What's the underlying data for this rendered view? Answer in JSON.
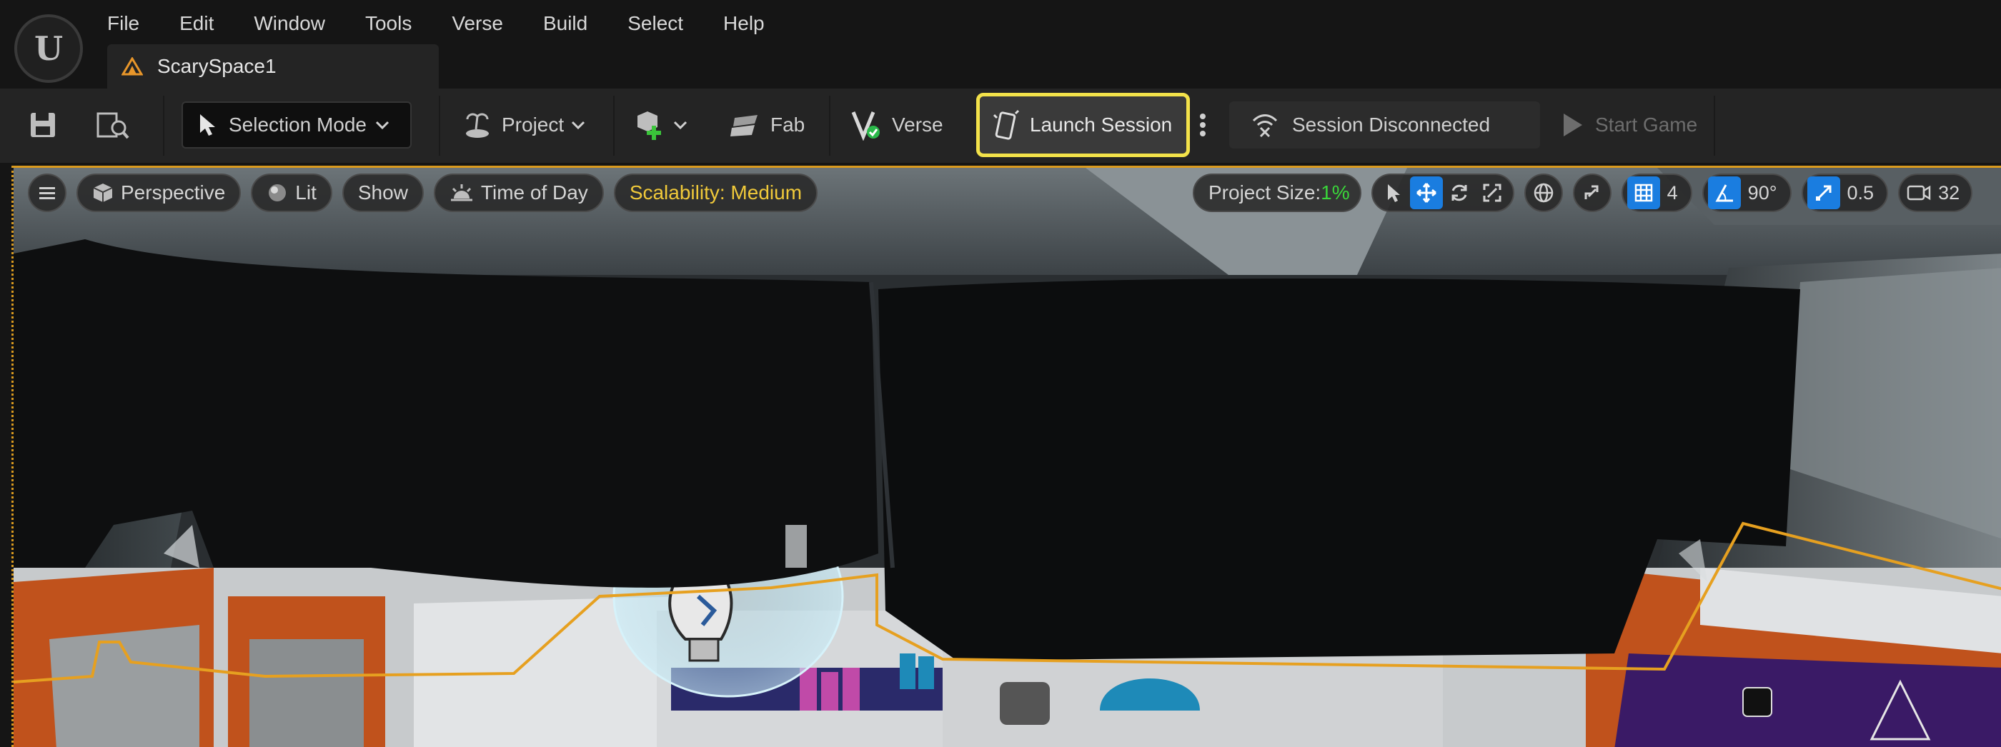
{
  "menu": [
    "File",
    "Edit",
    "Window",
    "Tools",
    "Verse",
    "Build",
    "Select",
    "Help"
  ],
  "tab": {
    "title": "ScarySpace1",
    "icon": "project-warning-icon"
  },
  "toolbar": {
    "save_icon": "save-icon",
    "browse_icon": "content-browser-icon",
    "selection_mode": "Selection Mode",
    "project": "Project",
    "add_icon": "add-actor-icon",
    "fab": "Fab",
    "verse": "Verse",
    "launch_session": "Launch Session",
    "session_status": "Session Disconnected",
    "start_game": "Start Game"
  },
  "viewport": {
    "perspective": "Perspective",
    "lit": "Lit",
    "show": "Show",
    "time_of_day": "Time of Day",
    "scalability": "Scalability: Medium",
    "project_size_label": "Project Size: ",
    "project_size_value": "1%",
    "grid_snap": "4",
    "rotation_snap": "90°",
    "scale_snap": "0.5",
    "camera_speed": "32"
  },
  "colors": {
    "accent_blue": "#1a7de0",
    "highlight_yellow": "#f3e24a",
    "selection_orange": "#d99a1e",
    "scalability_yellow": "#f0c93a",
    "project_size_green": "#3ad63a"
  }
}
